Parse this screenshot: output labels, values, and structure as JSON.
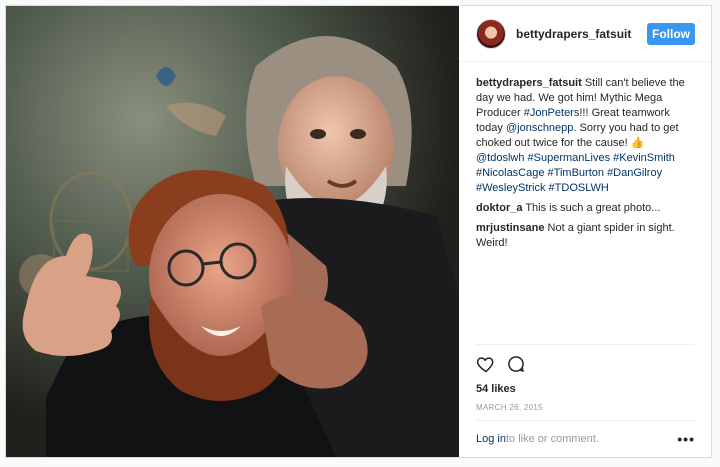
{
  "post": {
    "username": "bettydrapers_fatsuit",
    "follow_label": "Follow",
    "caption": {
      "author": "bettydrapers_fatsuit",
      "text1": " Still can't believe the day we had. We got him! Mythic Mega Producer ",
      "tag_jonpeters": "#JonPeters",
      "text2": "!!! Great teamwork today ",
      "mention": "@jonschnepp",
      "text3": ". Sorry you had to get choked out twice for the cause! 👍 ",
      "tags": [
        "@tdoslwh",
        "#SupermanLives",
        "#KevinSmith",
        "#NicolasCage",
        "#TimBurton",
        "#DanGilroy",
        "#WesleyStrick",
        "#TDOSLWH"
      ]
    },
    "comments": [
      {
        "author": "doktor_a",
        "text": " This is such a great photo..."
      },
      {
        "author": "mrjustinsane",
        "text": " Not a giant spider in sight. Weird!"
      }
    ],
    "likes": "54 likes",
    "date": "MARCH 26, 2015",
    "login_link": "Log in",
    "login_text": " to like or comment.",
    "more_label": "•••"
  },
  "icons": {
    "like": "heart-outline",
    "comment": "speech-bubble",
    "more": "ellipsis"
  },
  "colors": {
    "accent": "#3897f0",
    "link": "#003569",
    "muted": "#999999",
    "text": "#262626"
  }
}
